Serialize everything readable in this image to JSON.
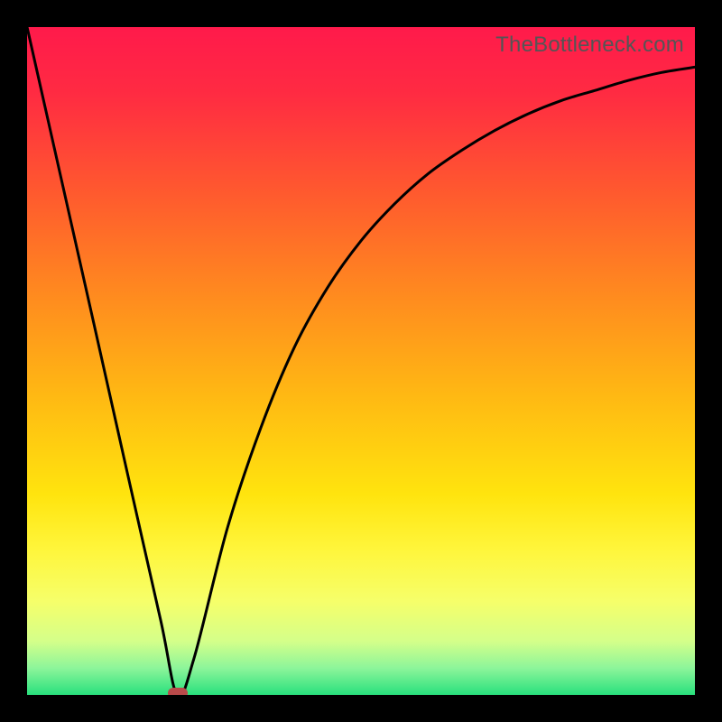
{
  "watermark": "TheBottleneck.com",
  "colors": {
    "frame": "#000000",
    "curve": "#000000",
    "marker": "#b94a4a",
    "gradient_stops": [
      {
        "pos": 0.0,
        "color": "#ff1a4b"
      },
      {
        "pos": 0.1,
        "color": "#ff2b42"
      },
      {
        "pos": 0.25,
        "color": "#ff5a2e"
      },
      {
        "pos": 0.4,
        "color": "#ff8a1f"
      },
      {
        "pos": 0.55,
        "color": "#ffb813"
      },
      {
        "pos": 0.7,
        "color": "#ffe40e"
      },
      {
        "pos": 0.78,
        "color": "#fff53a"
      },
      {
        "pos": 0.86,
        "color": "#f6ff6a"
      },
      {
        "pos": 0.92,
        "color": "#d4ff8a"
      },
      {
        "pos": 0.96,
        "color": "#8cf59a"
      },
      {
        "pos": 1.0,
        "color": "#28e07d"
      }
    ]
  },
  "chart_data": {
    "type": "line",
    "title": "",
    "xlabel": "",
    "ylabel": "",
    "xlim": [
      0,
      100
    ],
    "ylim": [
      0,
      100
    ],
    "x": [
      0,
      5,
      10,
      15,
      20,
      22.5,
      25,
      30,
      35,
      40,
      45,
      50,
      55,
      60,
      65,
      70,
      75,
      80,
      85,
      90,
      95,
      100
    ],
    "values": [
      100,
      77.8,
      55.6,
      33.3,
      11.2,
      0,
      5.5,
      25,
      40,
      52,
      61,
      68,
      73.5,
      78,
      81.5,
      84.5,
      87,
      89,
      90.5,
      92,
      93.2,
      94
    ],
    "optimum_x": 22.5,
    "grid": false,
    "legend": false
  }
}
